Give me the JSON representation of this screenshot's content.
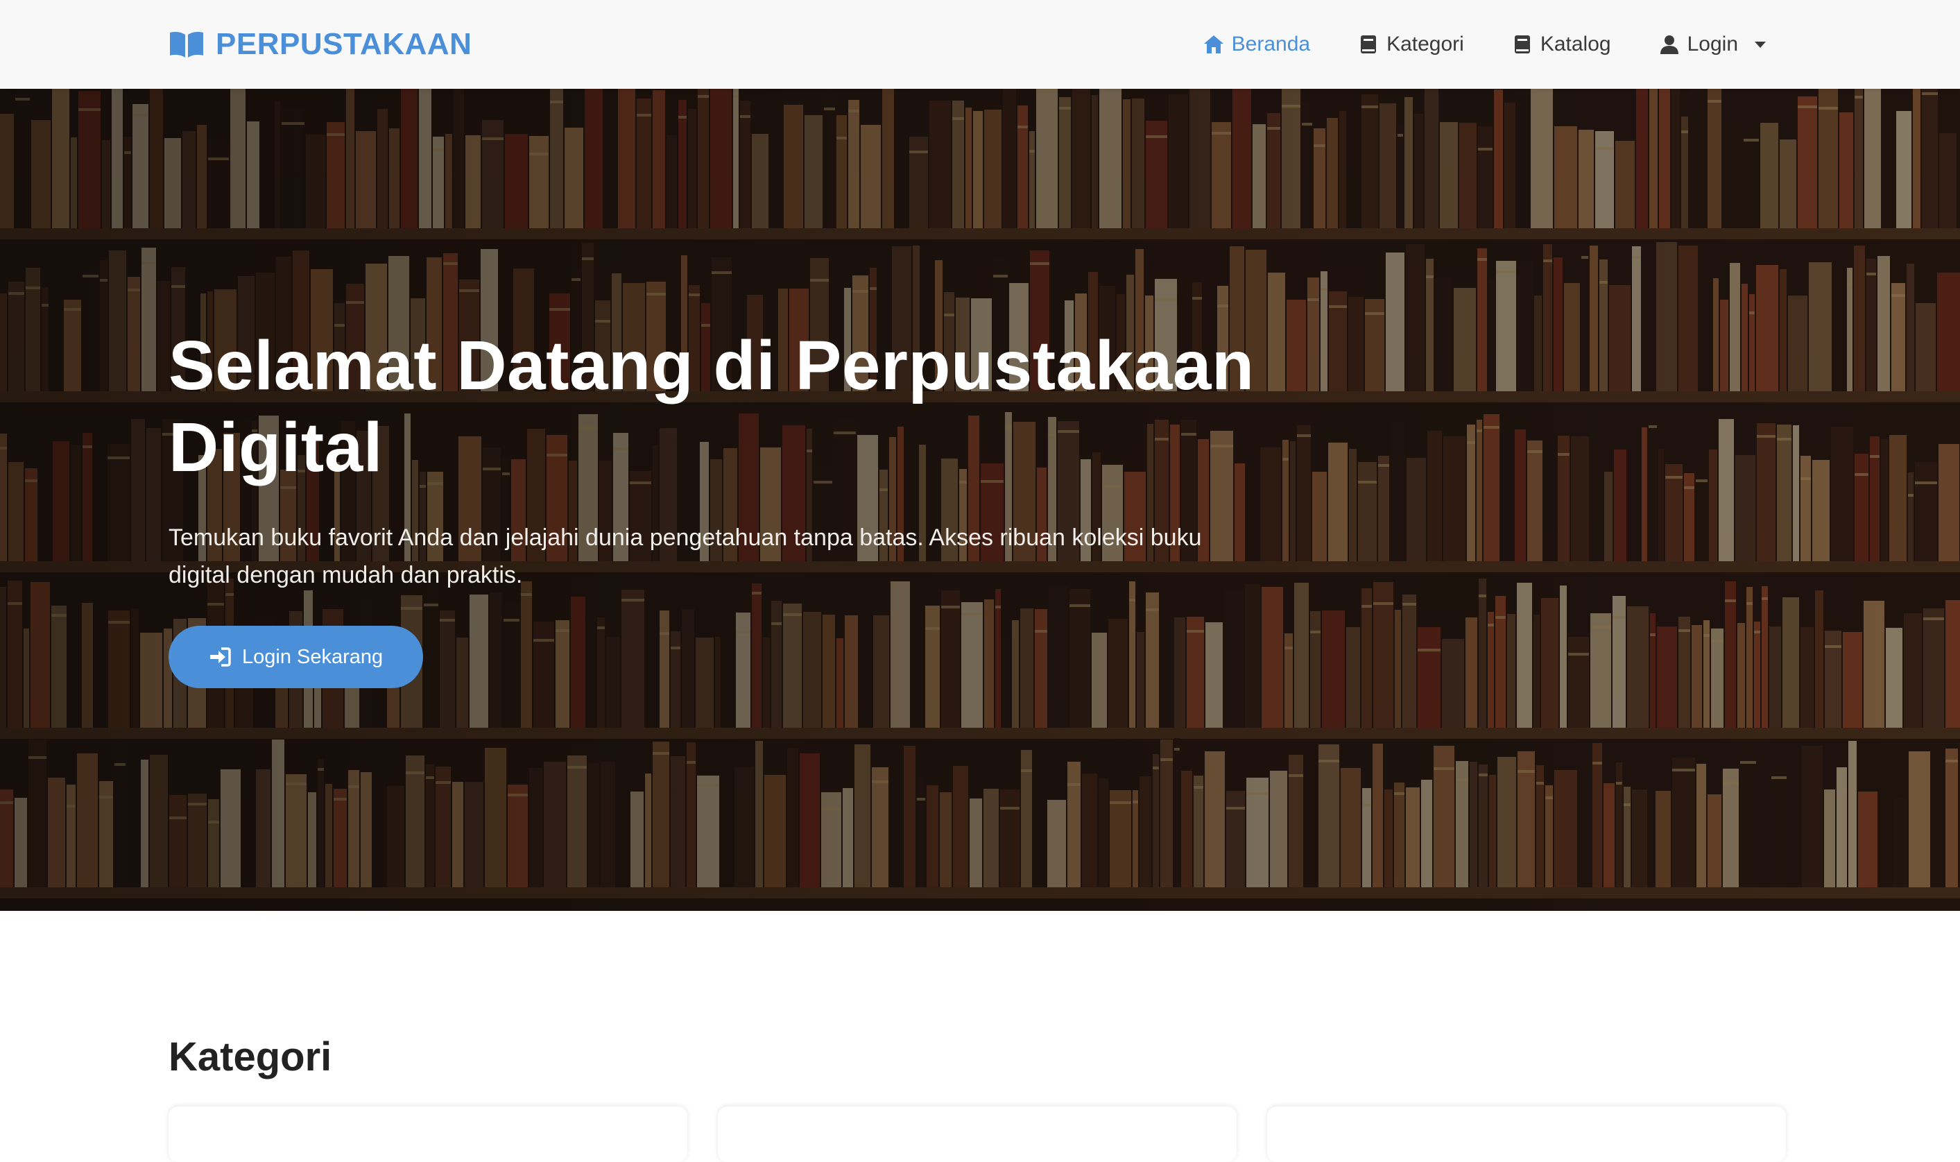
{
  "navbar": {
    "brand": "PERPUSTAKAAN",
    "brand_icon": "book-open-icon",
    "links": [
      {
        "label": "Beranda",
        "icon": "home-icon",
        "active": true
      },
      {
        "label": "Kategori",
        "icon": "book-icon",
        "active": false
      },
      {
        "label": "Katalog",
        "icon": "book-icon",
        "active": false
      },
      {
        "label": "Login",
        "icon": "user-icon",
        "active": false,
        "dropdown": true
      }
    ]
  },
  "hero": {
    "title": "Selamat Datang di Perpustakaan Digital",
    "description": "Temukan buku favorit Anda dan jelajahi dunia pengetahuan tanpa batas. Akses ribuan koleksi buku digital dengan mudah dan praktis.",
    "button_label": "Login Sekarang",
    "button_icon": "sign-in-icon"
  },
  "kategori": {
    "title": "Kategori"
  },
  "colors": {
    "accent": "#4a8fd8",
    "navbar_bg": "#f8f8f8"
  }
}
